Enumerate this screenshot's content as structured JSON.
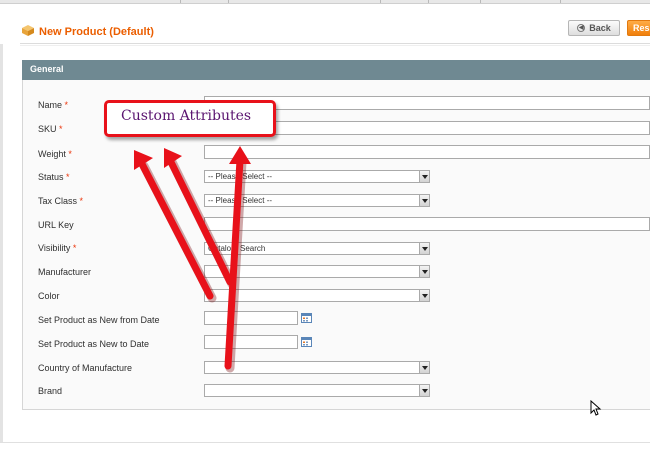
{
  "page": {
    "title": "New Product (Default)",
    "back_label": "Back",
    "reset_label": "Res"
  },
  "section": {
    "title": "General"
  },
  "fields": [
    {
      "label": "Name",
      "required": "*",
      "type": "text",
      "value": ""
    },
    {
      "label": "SKU",
      "required": "*",
      "type": "text",
      "value": ""
    },
    {
      "label": "Weight",
      "required": "*",
      "type": "text",
      "value": ""
    },
    {
      "label": "Status",
      "required": "*",
      "type": "select",
      "value": "-- Please Select --"
    },
    {
      "label": "Tax Class",
      "required": "*",
      "type": "select",
      "value": "-- Please Select --"
    },
    {
      "label": "URL Key",
      "required": "",
      "type": "text",
      "value": ""
    },
    {
      "label": "Visibility",
      "required": "*",
      "type": "select",
      "value": "Catalog, Search"
    },
    {
      "label": "Manufacturer",
      "required": "",
      "type": "select",
      "value": ""
    },
    {
      "label": "Color",
      "required": "",
      "type": "select",
      "value": ""
    },
    {
      "label": "Set Product as New from Date",
      "required": "",
      "type": "date",
      "value": ""
    },
    {
      "label": "Set Product as New to Date",
      "required": "",
      "type": "date",
      "value": ""
    },
    {
      "label": "Country of Manufacture",
      "required": "",
      "type": "select",
      "value": ""
    },
    {
      "label": "Brand",
      "required": "",
      "type": "select",
      "value": ""
    }
  ],
  "annotation": {
    "text": "Custom Attributes",
    "border_color": "#e8111a",
    "text_color": "#5a1470"
  },
  "colors": {
    "title": "#eb5e00",
    "section_header": "#6f8992",
    "required": "#eb340a",
    "reset_button": "#f17f0b"
  },
  "icons": {
    "page": "box-icon",
    "back": "back-arrow-icon",
    "date": "calendar-icon",
    "cursor": "mouse-pointer-icon"
  }
}
